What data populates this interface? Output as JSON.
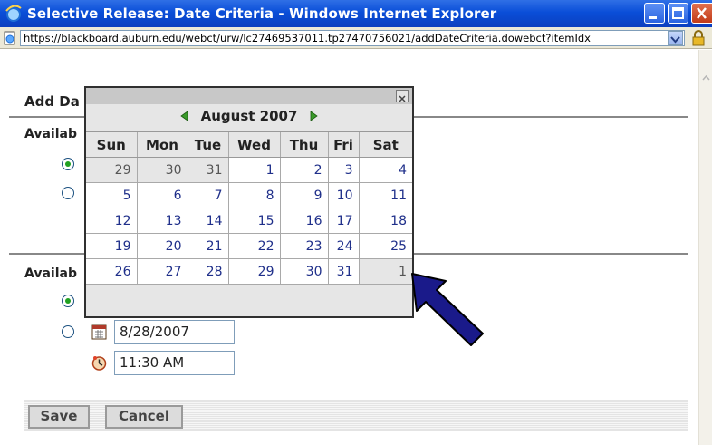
{
  "window": {
    "title": "Selective Release: Date Criteria - Windows Internet Explorer",
    "url": "https://blackboard.auburn.edu/webct/urw/lc27469537011.tp27470756021/addDateCriteria.dowebct?itemIdx"
  },
  "page": {
    "heading": "Add Da",
    "section1_label": "Availab",
    "section2_label": "Availab",
    "date_value": "8/28/2007",
    "time_value": "11:30 AM",
    "save_label": "Save",
    "cancel_label": "Cancel"
  },
  "calendar": {
    "month_label": "August 2007",
    "weekdays": [
      "Sun",
      "Mon",
      "Tue",
      "Wed",
      "Thu",
      "Fri",
      "Sat"
    ],
    "weeks": [
      [
        {
          "d": "29",
          "o": true
        },
        {
          "d": "30",
          "o": true
        },
        {
          "d": "31",
          "o": true
        },
        {
          "d": "1"
        },
        {
          "d": "2"
        },
        {
          "d": "3"
        },
        {
          "d": "4"
        }
      ],
      [
        {
          "d": "5"
        },
        {
          "d": "6"
        },
        {
          "d": "7"
        },
        {
          "d": "8"
        },
        {
          "d": "9"
        },
        {
          "d": "10"
        },
        {
          "d": "11"
        }
      ],
      [
        {
          "d": "12"
        },
        {
          "d": "13"
        },
        {
          "d": "14"
        },
        {
          "d": "15"
        },
        {
          "d": "16"
        },
        {
          "d": "17"
        },
        {
          "d": "18"
        }
      ],
      [
        {
          "d": "19"
        },
        {
          "d": "20"
        },
        {
          "d": "21"
        },
        {
          "d": "22"
        },
        {
          "d": "23"
        },
        {
          "d": "24"
        },
        {
          "d": "25"
        }
      ],
      [
        {
          "d": "26"
        },
        {
          "d": "27"
        },
        {
          "d": "28"
        },
        {
          "d": "29"
        },
        {
          "d": "30"
        },
        {
          "d": "31"
        },
        {
          "d": "1",
          "o": true
        }
      ]
    ]
  },
  "colors": {
    "title_bar": "#0a4ed8",
    "calendar_day_text": "#1f2f8a",
    "pointer_arrow": "#1a1a8a"
  },
  "icons": [
    "ie-logo-icon",
    "minimize-icon",
    "maximize-icon",
    "close-icon",
    "page-icon",
    "dropdown-icon",
    "lock-icon",
    "calendar-icon",
    "clock-icon",
    "prev-month-icon",
    "next-month-icon",
    "scroll-up-icon"
  ]
}
